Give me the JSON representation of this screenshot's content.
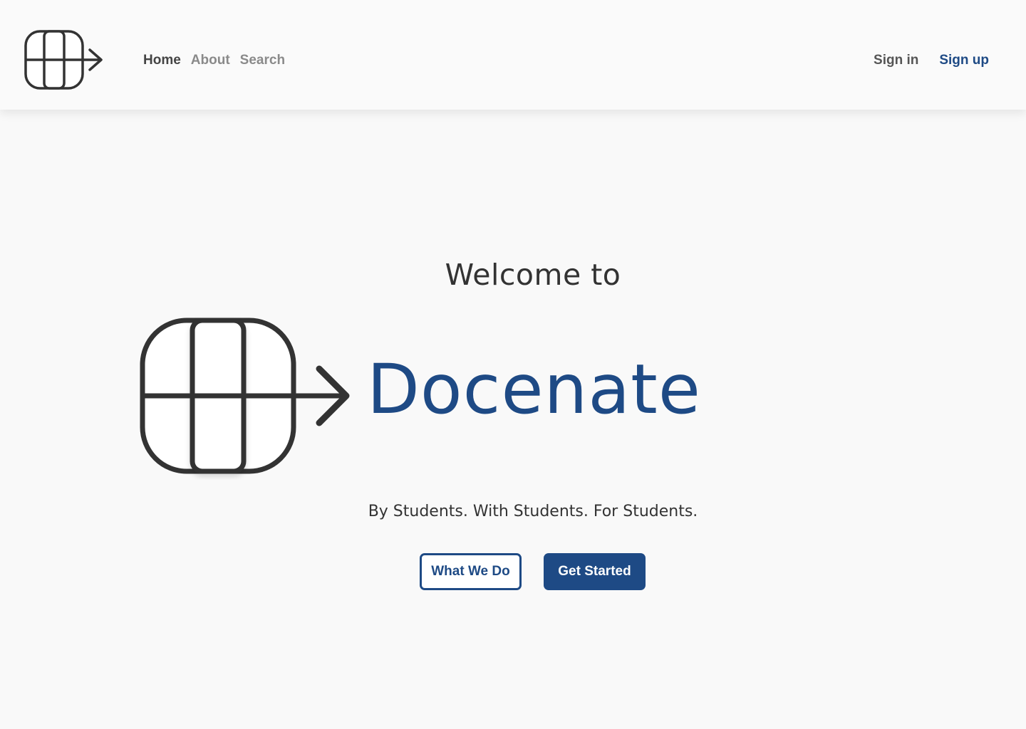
{
  "nav": {
    "logo_icon": "docenate-grid-arrow-icon",
    "links": [
      {
        "label": "Home",
        "active": true
      },
      {
        "label": "About",
        "active": false
      },
      {
        "label": "Search",
        "active": false
      }
    ],
    "sign_in": "Sign in",
    "sign_up": "Sign up"
  },
  "hero": {
    "welcome": "Welcome to",
    "brand": "Docenate",
    "logo_icon": "docenate-grid-arrow-icon",
    "tagline": "By Students. With Students. For Students.",
    "buttons": {
      "what_we_do": "What We Do",
      "get_started": "Get Started"
    }
  },
  "colors": {
    "brand_blue": "#1e4a85",
    "text_dark": "#333333",
    "background": "#f9f9f9"
  }
}
